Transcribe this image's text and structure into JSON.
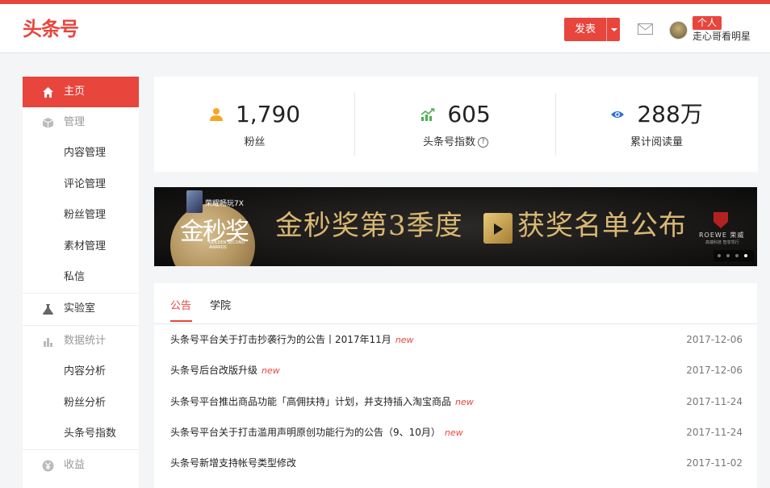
{
  "header": {
    "logo": "头条号",
    "publish_label": "发表",
    "badge": "个人",
    "username": "走心哥看明星"
  },
  "sidebar": {
    "items": [
      {
        "label": "主页",
        "icon": "home-icon"
      },
      {
        "label": "管理",
        "icon": "box-icon"
      },
      {
        "label": "内容管理"
      },
      {
        "label": "评论管理"
      },
      {
        "label": "粉丝管理"
      },
      {
        "label": "素材管理"
      },
      {
        "label": "私信"
      },
      {
        "label": "实验室",
        "icon": "flask-icon"
      },
      {
        "label": "数据统计",
        "icon": "bar-chart-icon"
      },
      {
        "label": "内容分析"
      },
      {
        "label": "粉丝分析"
      },
      {
        "label": "头条号指数"
      },
      {
        "label": "收益",
        "icon": "yen-icon"
      }
    ]
  },
  "stats": [
    {
      "value": "1,790",
      "label": "粉丝",
      "icon": "user-icon",
      "color": "#f5a623"
    },
    {
      "value": "605",
      "label": "头条号指数",
      "icon": "trend-icon",
      "color": "#4caf50",
      "help": "?"
    },
    {
      "value": "288万",
      "label": "累计阅读量",
      "icon": "eye-icon",
      "color": "#2d6fd8"
    }
  ],
  "banner": {
    "badge_text": "荣耀畅玩7X",
    "disc_text": "金秒奖",
    "disc_sub": "GOLDEN SECOND AWARDS",
    "headline_left": "金秒奖第3季度",
    "headline_right": "获奖名单公布",
    "sponsor": "ROEWE 荣威",
    "sponsor_sub": "高端科技 智享驾行"
  },
  "news": {
    "tabs": [
      "公告",
      "学院"
    ],
    "new_label": "new",
    "items": [
      {
        "title": "头条号平台关于打击抄袭行为的公告丨2017年11月",
        "is_new": true,
        "date": "2017-12-06"
      },
      {
        "title": "头条号后台改版升级",
        "is_new": true,
        "date": "2017-12-06"
      },
      {
        "title": "头条号平台推出商品功能「高佣扶持」计划，并支持插入淘宝商品",
        "is_new": true,
        "date": "2017-11-24"
      },
      {
        "title": "头条号平台关于打击滥用声明原创功能行为的公告（9、10月）",
        "is_new": true,
        "date": "2017-11-24"
      },
      {
        "title": "头条号新增支持帐号类型修改",
        "is_new": false,
        "date": "2017-11-02"
      }
    ]
  },
  "colors": {
    "accent": "#e8453c"
  }
}
